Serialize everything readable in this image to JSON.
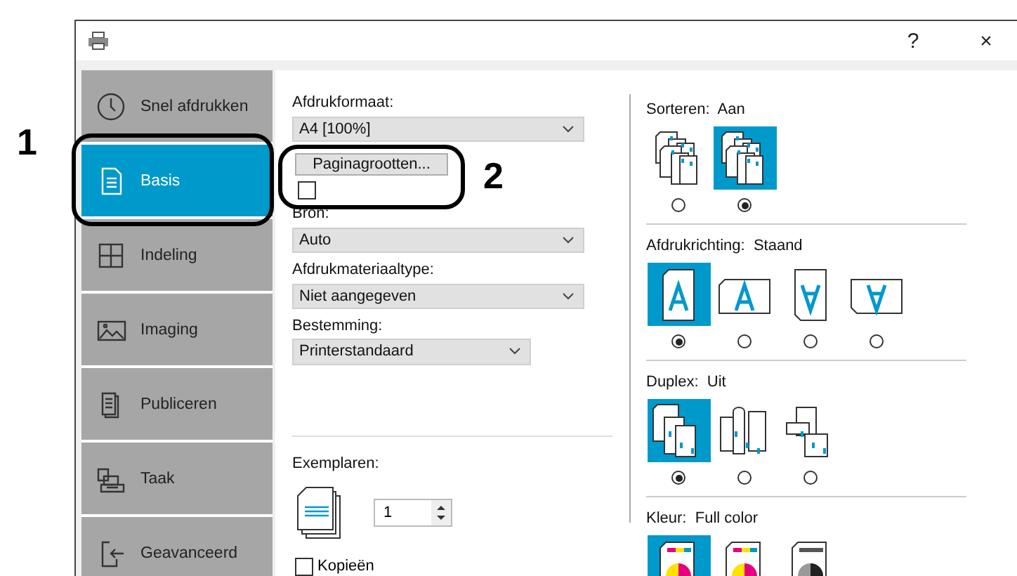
{
  "window": {
    "help": "?",
    "close": "×"
  },
  "sidebar": {
    "items": [
      {
        "label": "Snel afdrukken",
        "kind": "clock",
        "selected": false
      },
      {
        "label": "Basis",
        "kind": "document",
        "selected": true
      },
      {
        "label": "Indeling",
        "kind": "grid",
        "selected": false
      },
      {
        "label": "Imaging",
        "kind": "image",
        "selected": false
      },
      {
        "label": "Publiceren",
        "kind": "pages",
        "selected": false
      },
      {
        "label": "Taak",
        "kind": "tray",
        "selected": false
      },
      {
        "label": "Geavanceerd",
        "kind": "exit",
        "selected": false
      }
    ]
  },
  "basic": {
    "fields": [
      {
        "label": "Afdrukformaat:",
        "value": "A4  [100%]",
        "wide": true
      },
      {
        "label": "Bron:",
        "value": "Auto",
        "wide": true
      },
      {
        "label": "Afdrukmateriaaltype:",
        "value": "Niet aangegeven",
        "wide": true
      },
      {
        "label": "Bestemming:",
        "value": "Printerstandaard",
        "wide": false
      }
    ],
    "page_sizes_button": "Paginagrootten...",
    "fit_checkbox": {
      "checked": false
    },
    "copies": {
      "label": "Exemplaren:",
      "value": "1"
    },
    "collate": {
      "label": "Kopieën",
      "checked": false
    }
  },
  "sections": [
    {
      "kind": "collate",
      "label": "Sorteren:",
      "value": "Aan",
      "options": [
        {
          "selected": false
        },
        {
          "selected": true
        }
      ],
      "radios": true
    },
    {
      "kind": "orientation",
      "label": "Afdrukrichting:",
      "value": "Staand",
      "options": [
        {
          "selected": true
        },
        {
          "selected": false
        },
        {
          "selected": false
        },
        {
          "selected": false
        }
      ],
      "radios": true
    },
    {
      "kind": "duplex",
      "label": "Duplex:",
      "value": "Uit",
      "options": [
        {
          "selected": true
        },
        {
          "selected": false
        },
        {
          "selected": false
        }
      ],
      "radios": true
    },
    {
      "kind": "color",
      "label": "Kleur:",
      "value": "Full color",
      "options": [
        {
          "selected": true
        },
        {
          "selected": false
        },
        {
          "selected": false
        }
      ],
      "radios": false
    }
  ],
  "callouts": [
    "1",
    "2"
  ]
}
